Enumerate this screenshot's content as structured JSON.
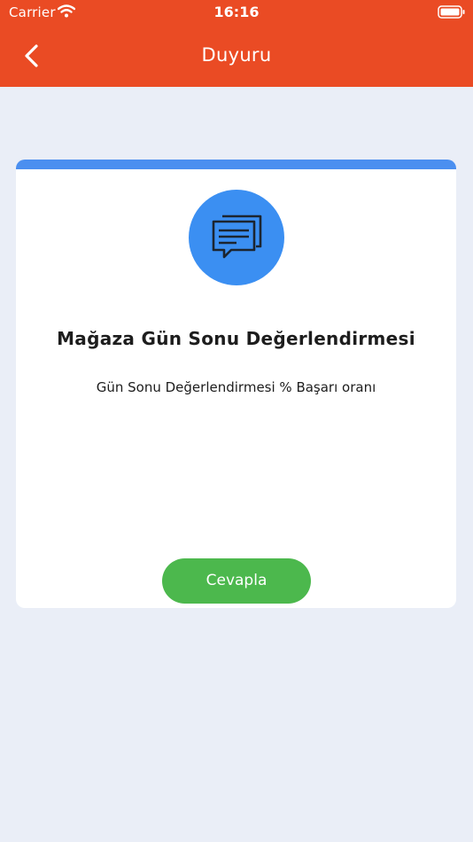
{
  "status_bar": {
    "carrier": "Carrier",
    "time": "16:16"
  },
  "nav": {
    "title": "Duyuru",
    "back_icon": "chevron-left-icon"
  },
  "announcement": {
    "icon": "chat-bubbles-icon",
    "title": "Mağaza Gün Sonu Değerlendirmesi",
    "description": "Gün Sonu Değerlendirmesi % Başarı oranı",
    "reply_label": "Cevapla"
  },
  "colors": {
    "header": "#ea4b24",
    "background": "#eaeef7",
    "card_accent": "#4b8ff0",
    "icon_circle": "#3b8ff2",
    "reply_button": "#4cb84d"
  }
}
